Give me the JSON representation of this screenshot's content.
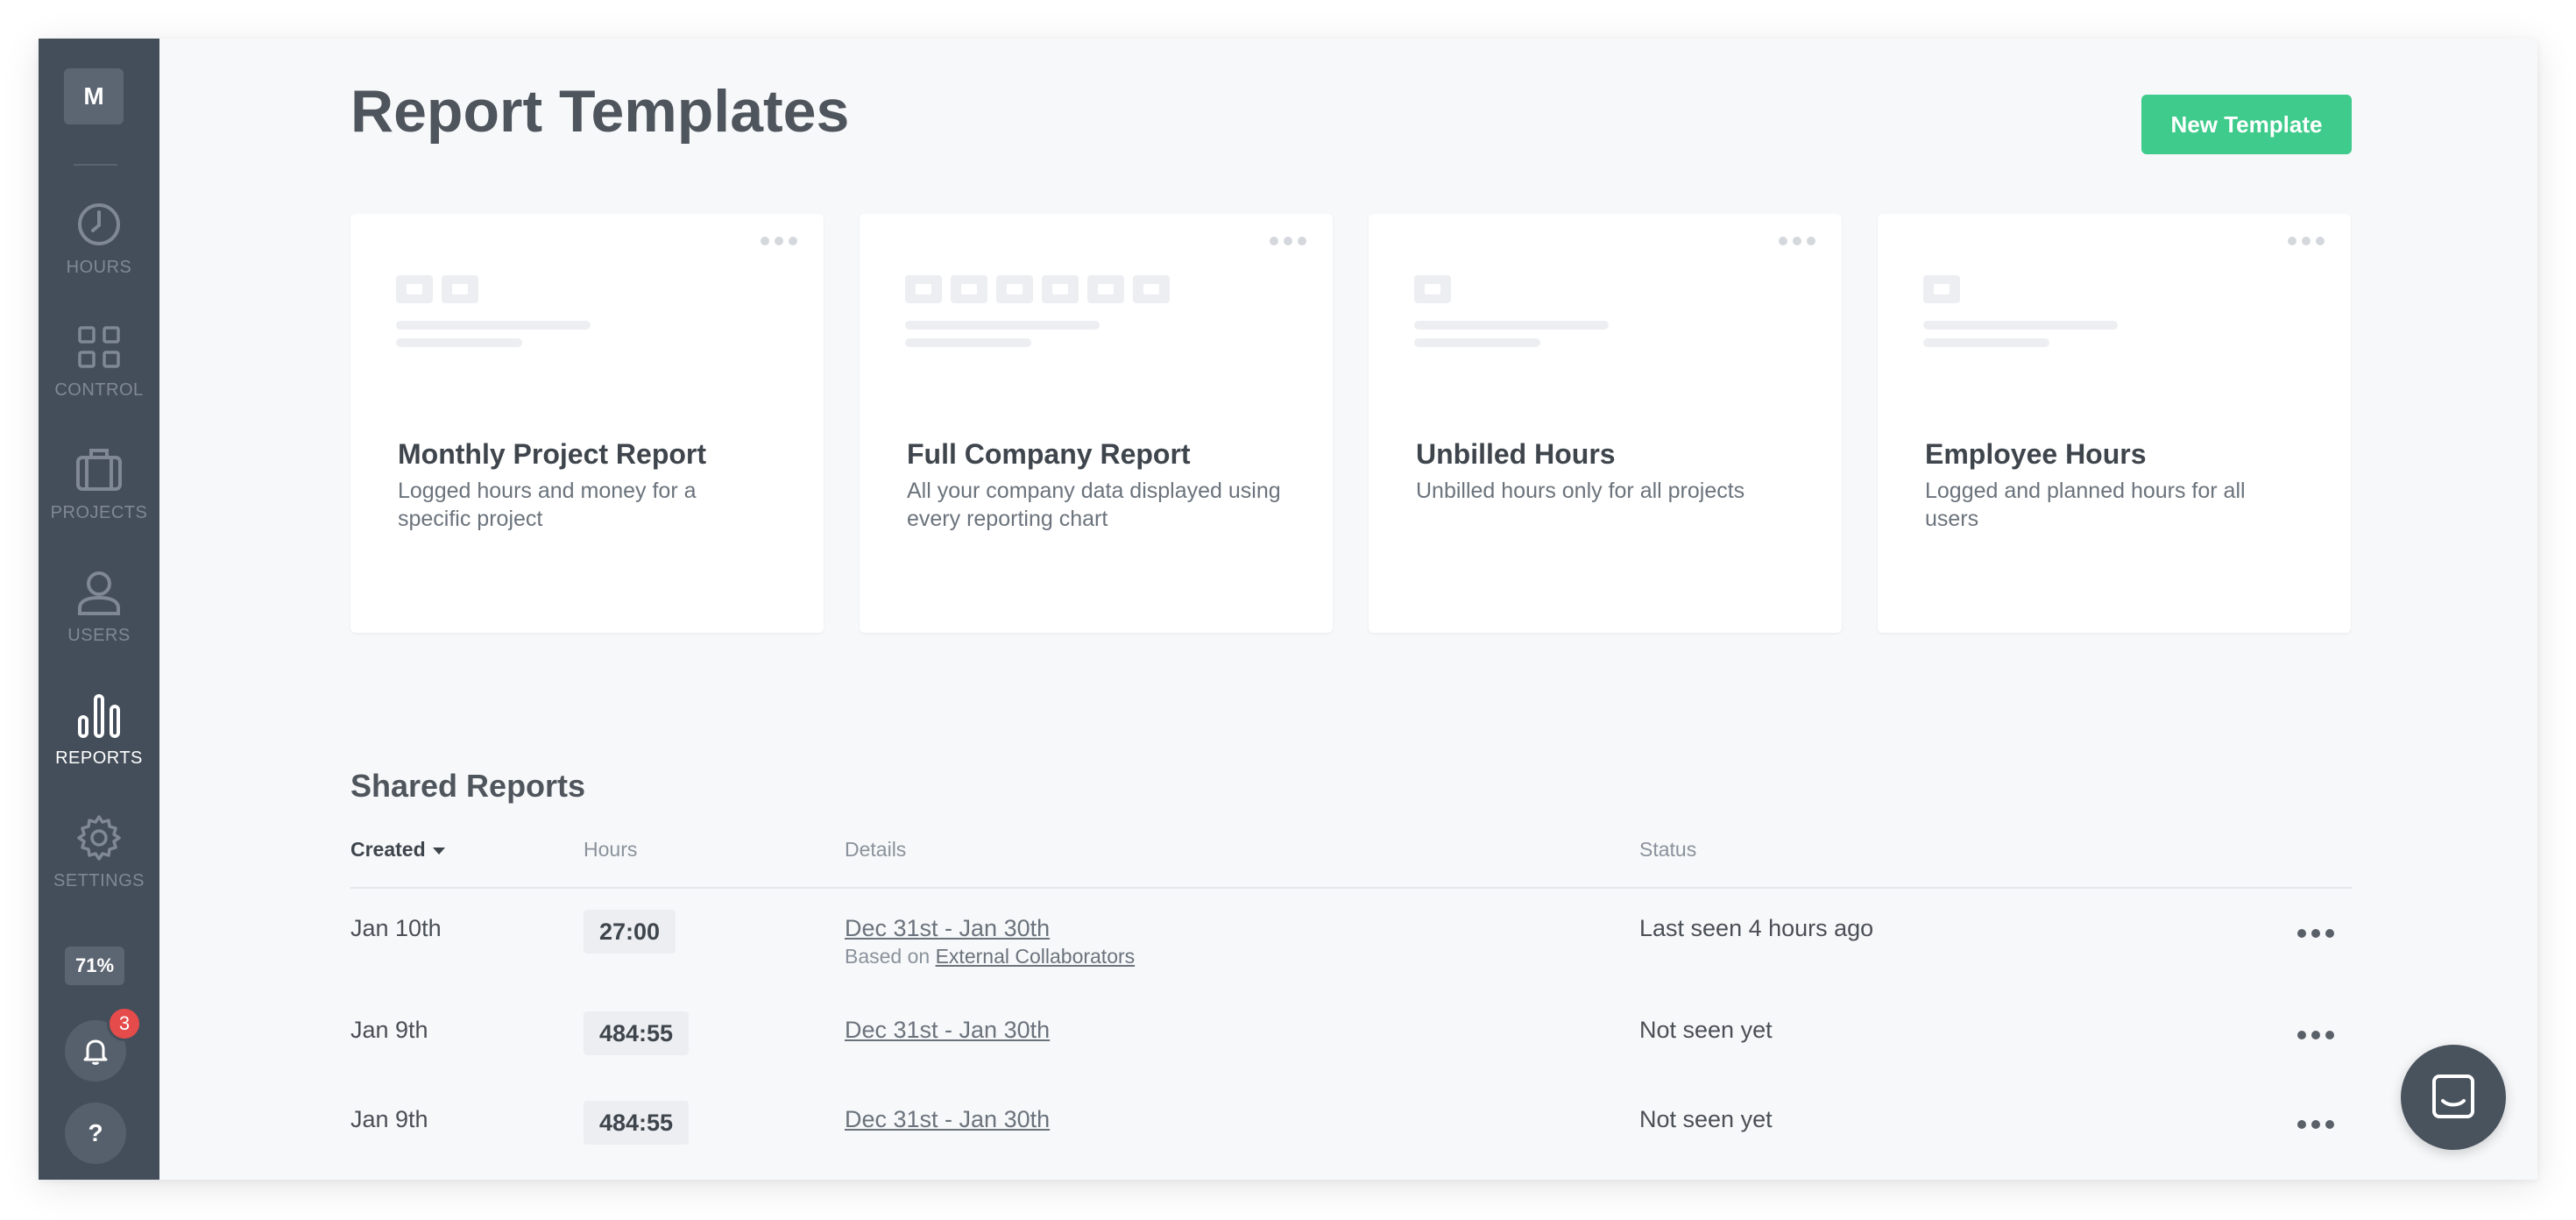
{
  "sidebar": {
    "avatar_initial": "M",
    "items": [
      {
        "label": "HOURS",
        "icon": "clock-icon"
      },
      {
        "label": "CONTROL",
        "icon": "grid-icon"
      },
      {
        "label": "PROJECTS",
        "icon": "briefcase-icon"
      },
      {
        "label": "USERS",
        "icon": "user-icon"
      },
      {
        "label": "REPORTS",
        "icon": "bar-chart-icon",
        "active": true
      },
      {
        "label": "SETTINGS",
        "icon": "gear-icon"
      }
    ],
    "zoom": "71%",
    "notification_count": "3",
    "help_label": "?"
  },
  "header": {
    "title": "Report Templates",
    "new_template_label": "New Template"
  },
  "templates": [
    {
      "title": "Monthly Project Report",
      "description": "Logged hours and money for a specific project",
      "icon_count": 2
    },
    {
      "title": "Full Company Report",
      "description": "All your company data displayed using every reporting chart",
      "icon_count": 6
    },
    {
      "title": "Unbilled Hours",
      "description": "Unbilled hours only for all projects",
      "icon_count": 1
    },
    {
      "title": "Employee Hours",
      "description": "Logged and planned hours for all users",
      "icon_count": 1
    }
  ],
  "shared_reports": {
    "title": "Shared Reports",
    "columns": {
      "created": "Created",
      "hours": "Hours",
      "details": "Details",
      "status": "Status"
    },
    "rows": [
      {
        "created": "Jan 10th",
        "hours": "27:00",
        "details": "Dec 31st - Jan 30th",
        "based_on_prefix": "Based on",
        "based_on": "External Collaborators",
        "status": "Last seen 4 hours ago"
      },
      {
        "created": "Jan 9th",
        "hours": "484:55",
        "details": "Dec 31st - Jan 30th",
        "status": "Not seen yet"
      },
      {
        "created": "Jan 9th",
        "hours": "484:55",
        "details": "Dec 31st - Jan 30th",
        "status": "Not seen yet"
      }
    ]
  },
  "colors": {
    "sidebar": "#444e5a",
    "accent_green": "#3ecb8b",
    "badge_red": "#e54b4b",
    "background": "#f7f8fa"
  }
}
